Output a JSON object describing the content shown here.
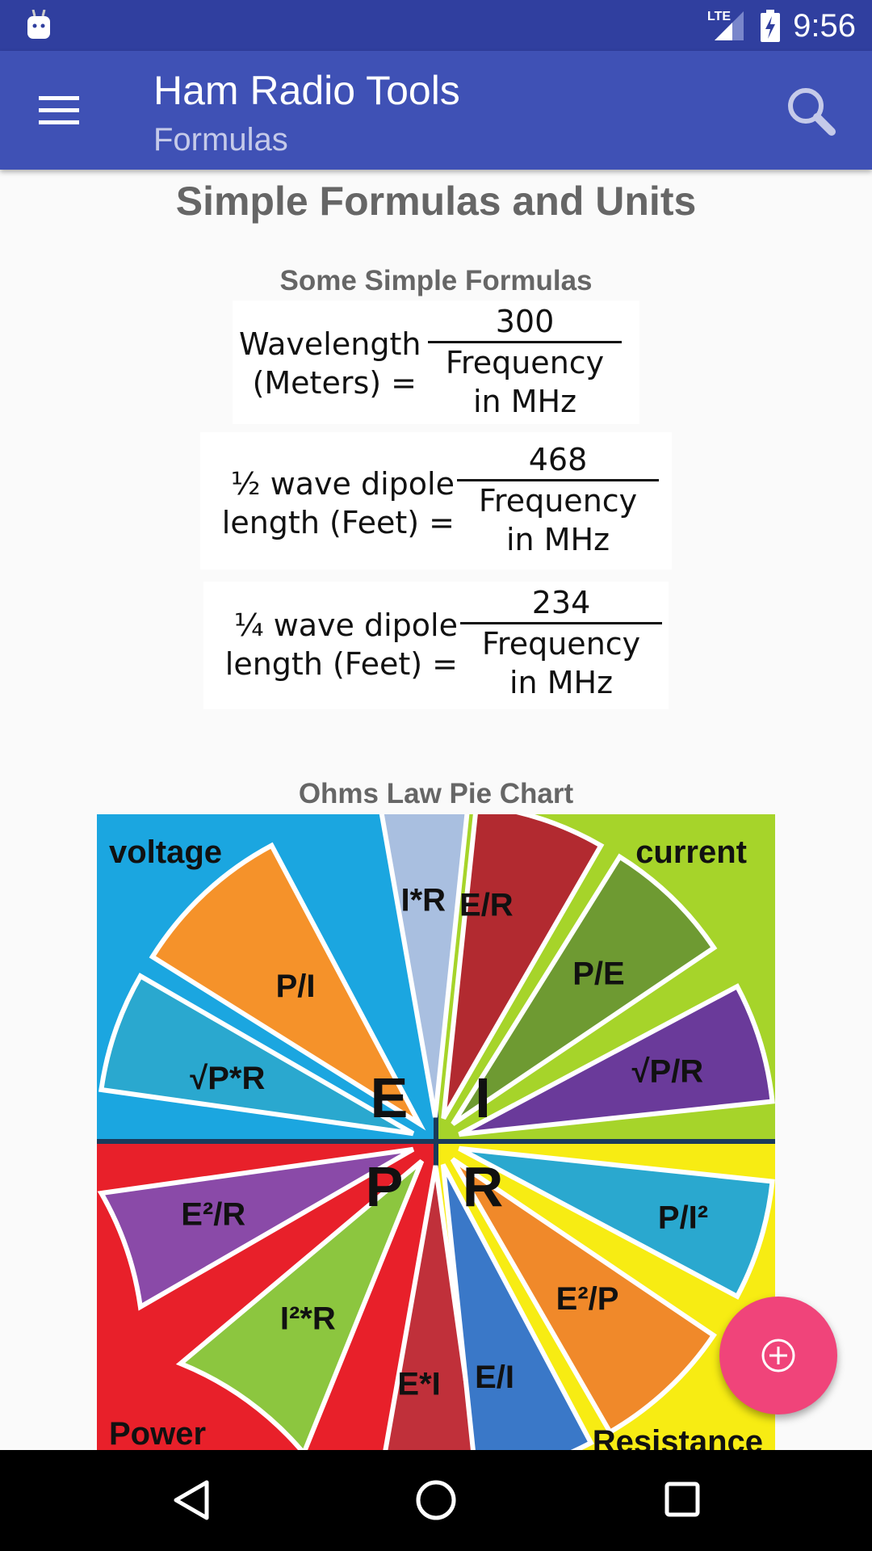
{
  "status_bar": {
    "time": "9:56",
    "network": "LTE",
    "icons": [
      "android-notification-icon",
      "signal-icon",
      "battery-charging-icon"
    ]
  },
  "app_bar": {
    "title": "Ham Radio Tools",
    "subtitle": "Formulas",
    "menu_icon": "hamburger-menu-icon",
    "search_icon": "search-icon"
  },
  "content": {
    "page_title": "Simple Formulas and Units",
    "formulas_heading": "Some Simple Formulas",
    "formulas": [
      {
        "lhs1": "Wavelength",
        "lhs2": "(Meters) =",
        "numerator": "300",
        "den1": "Frequency",
        "den2": "in MHz"
      },
      {
        "lhs1": "½ wave dipole",
        "lhs2": "length (Feet) =",
        "numerator": "468",
        "den1": "Frequency",
        "den2": "in MHz"
      },
      {
        "lhs1": "¼ wave dipole",
        "lhs2": "length (Feet) =",
        "numerator": "234",
        "den1": "Frequency",
        "den2": "in MHz"
      }
    ],
    "pie_heading": "Ohms Law Pie Chart",
    "pie": {
      "quadrants": [
        {
          "name": "voltage",
          "letter": "E",
          "color": "#1ba6e0",
          "formulas": [
            "I*R",
            "P/I",
            "√P*R"
          ]
        },
        {
          "name": "current",
          "letter": "I",
          "color": "#a6d42a",
          "formulas": [
            "E/R",
            "P/E",
            "√P/R"
          ]
        },
        {
          "name": "Power",
          "letter": "P",
          "color": "#e8202a",
          "formulas": [
            "E²/R",
            "I²*R",
            "E*I"
          ]
        },
        {
          "name": "Resistance",
          "letter": "R",
          "color": "#f7ec13",
          "formulas": [
            "P/I²",
            "E²/P",
            "E/I"
          ]
        }
      ]
    }
  },
  "fab": {
    "icon": "add-circle-icon",
    "color": "#f0447a"
  },
  "nav_bar": {
    "icons": [
      "back-icon",
      "home-icon",
      "recents-icon"
    ]
  }
}
